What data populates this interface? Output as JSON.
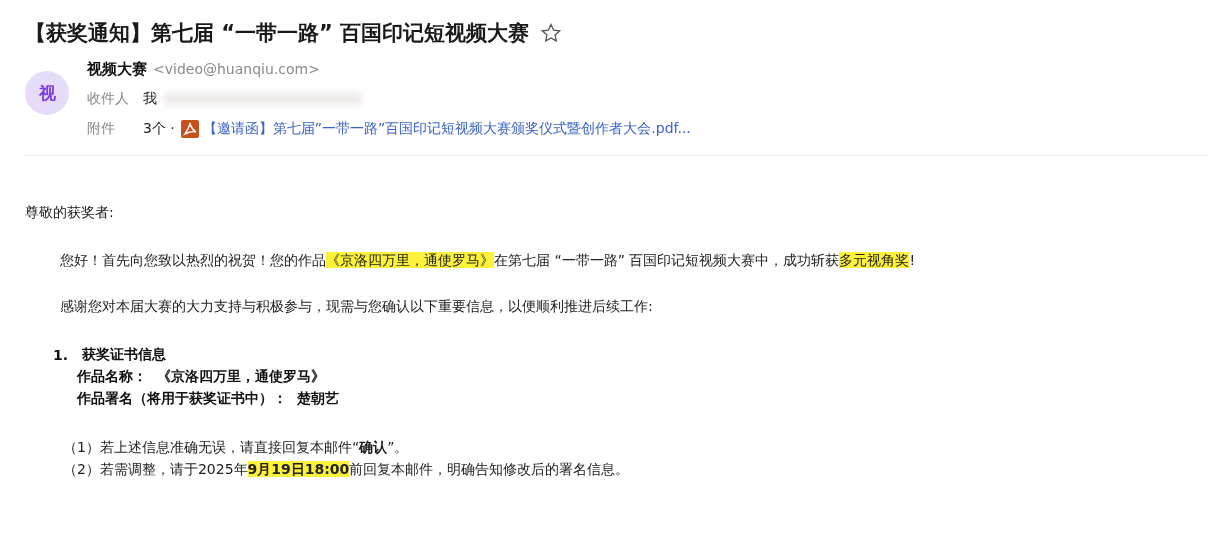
{
  "subject": {
    "title": "【获奖通知】第七届 “一带一路” 百国印记短视频大赛",
    "starred": false
  },
  "sender": {
    "avatar": "视",
    "name": "视频大赛",
    "address": "<video@huanqiu.com>"
  },
  "recipients": {
    "label": "收件人",
    "value": "我"
  },
  "attachments": {
    "label": "附件",
    "count": "3个 ·",
    "file": "【邀请函】第七届”一带一路”百国印记短视频大赛颁奖仪式暨创作者大会.pdf..."
  },
  "body": {
    "greeting": "尊敬的获奖者:",
    "paragraphs": [
      [
        {
          "text": "您好！首先向您致以热烈的祝贺！您的作品",
          "highlight": false
        },
        {
          "text": "《京洛四万里，通使罗马》",
          "highlight": true
        },
        {
          "text": "在第七届 “一带一路” 百国印记短视频大赛中，成功斩获",
          "highlight": false
        },
        {
          "text": "多元视角奖",
          "highlight": true
        },
        {
          "text": "!",
          "highlight": false
        }
      ],
      [
        {
          "text": "感谢您对本届大赛的大力支持与积极参与，现需与您确认以下重要信息，以便顺利推进后续工作:",
          "highlight": false
        }
      ]
    ],
    "section": {
      "number": "1.",
      "heading": "获奖证书信息",
      "lines": [
        {
          "label": "作品名称：",
          "value": "《京洛四万里，通使罗马》"
        },
        {
          "label": "作品署名（将用于获奖证书中）：",
          "value": "楚朝艺"
        }
      ]
    },
    "notes": [
      [
        {
          "text": "（1）若上述信息准确无误，请直接回复本邮件“**确认**”。",
          "highlight": false
        }
      ],
      [
        {
          "text": "（2）若需调整，请于2025年",
          "highlight": false
        },
        {
          "text": "**9月19日18:00**",
          "highlight": true
        },
        {
          "text": "前回复本邮件，明确告知修改后的署名信息。",
          "highlight": false
        }
      ]
    ]
  }
}
